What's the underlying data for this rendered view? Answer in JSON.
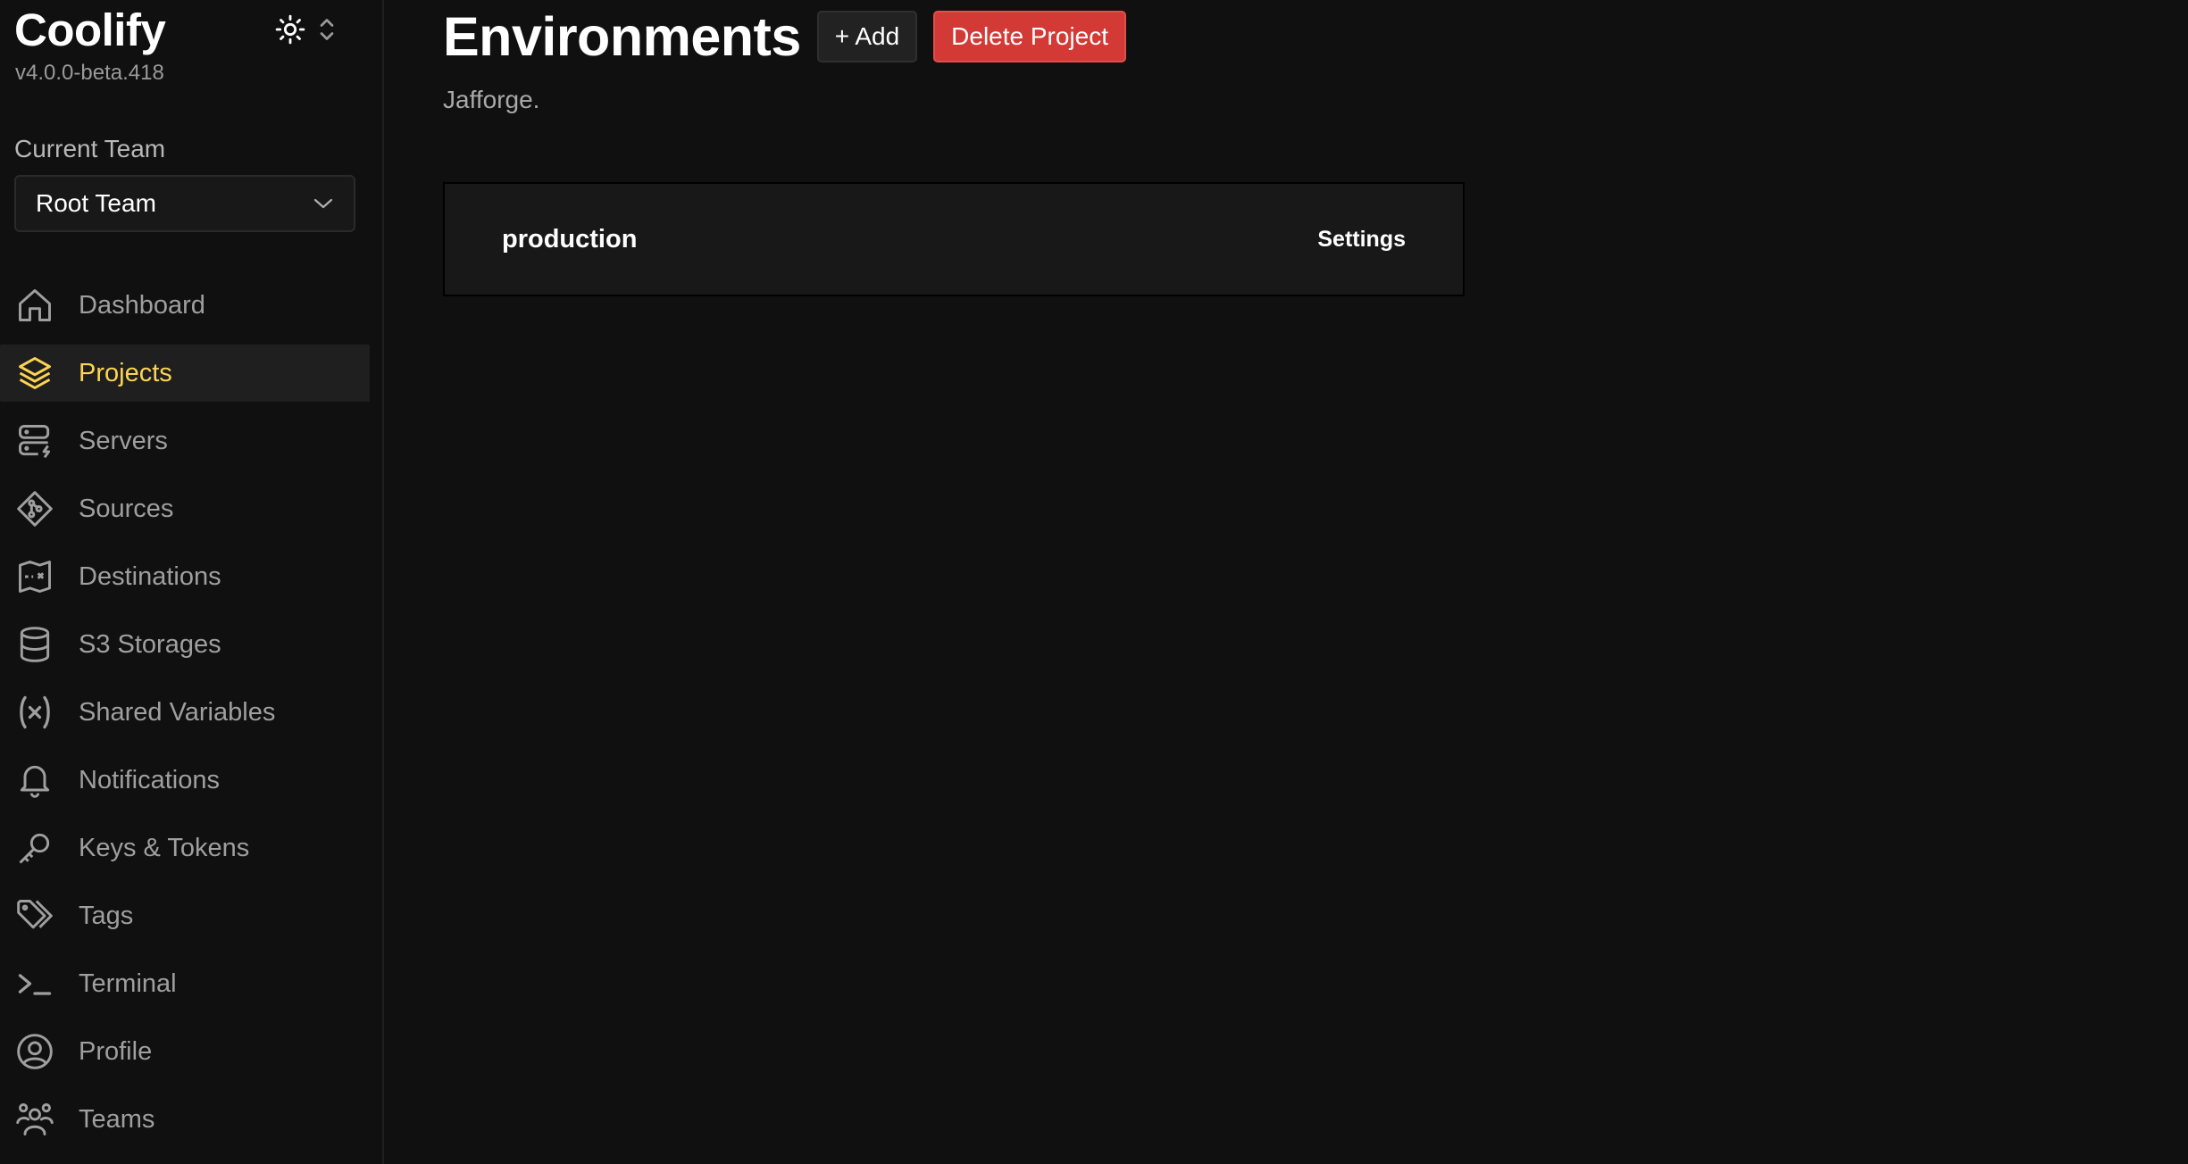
{
  "sidebar": {
    "brand": "Coolify",
    "version": "v4.0.0-beta.418",
    "theme_icon": "sun-icon",
    "team": {
      "label": "Current Team",
      "selected": "Root Team"
    },
    "items": [
      {
        "label": "Dashboard",
        "icon": "home-icon"
      },
      {
        "label": "Projects",
        "icon": "layers-icon",
        "active": true
      },
      {
        "label": "Servers",
        "icon": "server-icon"
      },
      {
        "label": "Sources",
        "icon": "git-icon"
      },
      {
        "label": "Destinations",
        "icon": "destination-icon"
      },
      {
        "label": "S3 Storages",
        "icon": "database-icon"
      },
      {
        "label": "Shared Variables",
        "icon": "variable-icon"
      },
      {
        "label": "Notifications",
        "icon": "bell-icon"
      },
      {
        "label": "Keys & Tokens",
        "icon": "key-icon"
      },
      {
        "label": "Tags",
        "icon": "tags-icon"
      },
      {
        "label": "Terminal",
        "icon": "terminal-icon"
      },
      {
        "label": "Profile",
        "icon": "user-circle-icon"
      },
      {
        "label": "Teams",
        "icon": "users-icon"
      }
    ]
  },
  "main": {
    "title": "Environments",
    "add_label": "+ Add",
    "delete_label": "Delete Project",
    "subtitle": "Jafforge.",
    "environments": [
      {
        "name": "production",
        "settings_label": "Settings"
      }
    ]
  },
  "colors": {
    "background": "#101010",
    "active_accent": "#fcd452",
    "danger": "#d33a35"
  }
}
